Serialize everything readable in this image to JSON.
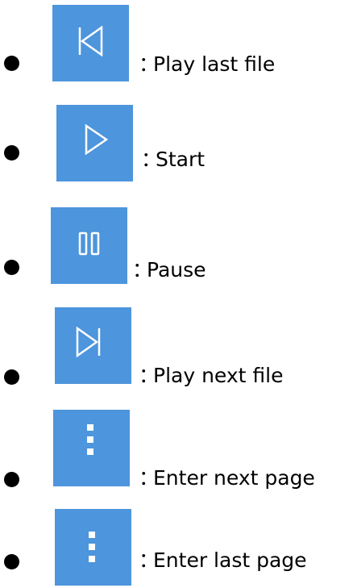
{
  "items": [
    {
      "icon": "skip-previous-icon",
      "label": "Play last file"
    },
    {
      "icon": "play-icon",
      "label": "Start"
    },
    {
      "icon": "pause-icon",
      "label": "Pause"
    },
    {
      "icon": "skip-next-icon",
      "label": "Play next file"
    },
    {
      "icon": "more-vertical-icon",
      "label": "Enter next page"
    },
    {
      "icon": "more-vertical-icon",
      "label": "Enter last page"
    }
  ],
  "separator": "：",
  "colors": {
    "button_bg": "#4d95dc",
    "icon_stroke": "#ffffff",
    "bullet": "#000000",
    "text": "#000000"
  }
}
